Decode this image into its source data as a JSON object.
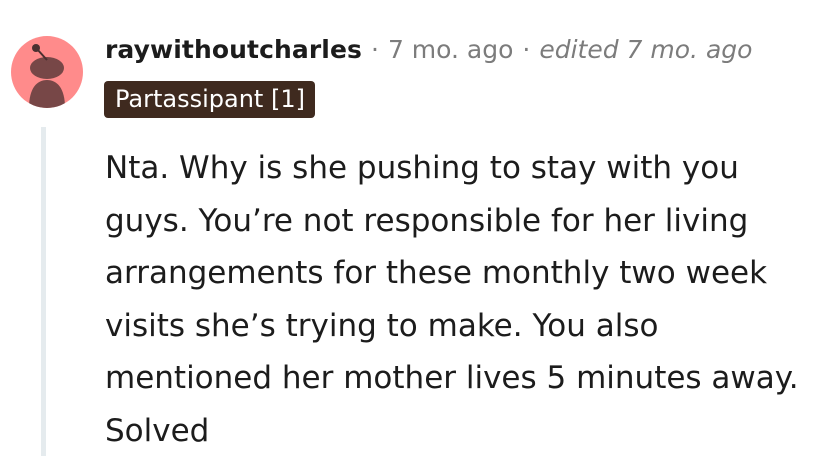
{
  "comment": {
    "username": "raywithoutcharles",
    "separator": "·",
    "time": "7 mo. ago",
    "edited": "edited 7 mo. ago",
    "flair": "Partassipant [1]",
    "body": "Nta. Why is she pushing to stay with you guys. You’re not responsible for her living arrangements for these monthly two week visits she’s trying to make. You also mentioned her mother lives 5 minutes away. Solved"
  },
  "avatar": {
    "icon": "snoo-avatar-icon",
    "background": "#ff8b8b"
  },
  "colors": {
    "flair_bg": "#3f2a1f",
    "meta_text": "#7c7c7c",
    "thread_line": "#e5ebee"
  }
}
